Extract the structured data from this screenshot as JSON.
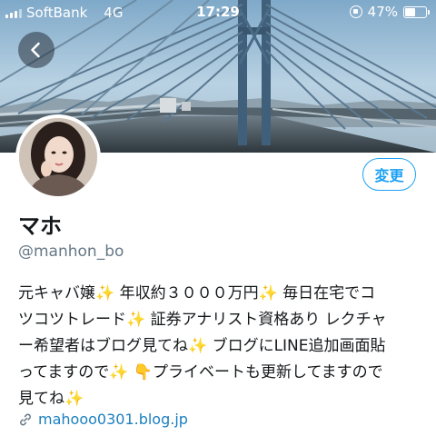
{
  "status_bar": {
    "carrier": "SoftBank",
    "network": "4G",
    "time": "17:29",
    "battery_percent": "47%",
    "battery_level": 0.47
  },
  "profile": {
    "display_name": "マホ",
    "handle": "@manhon_bo",
    "edit_button": "変更",
    "bio_lines": [
      "元キャバ嬢✨ 年収約３０００万円✨ 毎日在宅でコ",
      "ツコツトレード✨ 証券アナリスト資格あり レクチャ",
      "ー希望者はブログ見てね✨ ブログにLINE追加画面貼",
      "ってますので✨ 👇プライベートも更新してますので",
      "見てね✨"
    ],
    "link": "mahooo0301.blog.jp"
  },
  "colors": {
    "accent": "#1da1f2",
    "link": "#1b7fc0",
    "muted": "#657786"
  },
  "icons": {
    "back": "chevron-left-icon",
    "link": "link-icon",
    "orientation_lock": "orientation-lock-icon",
    "battery": "battery-icon",
    "signal": "signal-bars-icon"
  }
}
